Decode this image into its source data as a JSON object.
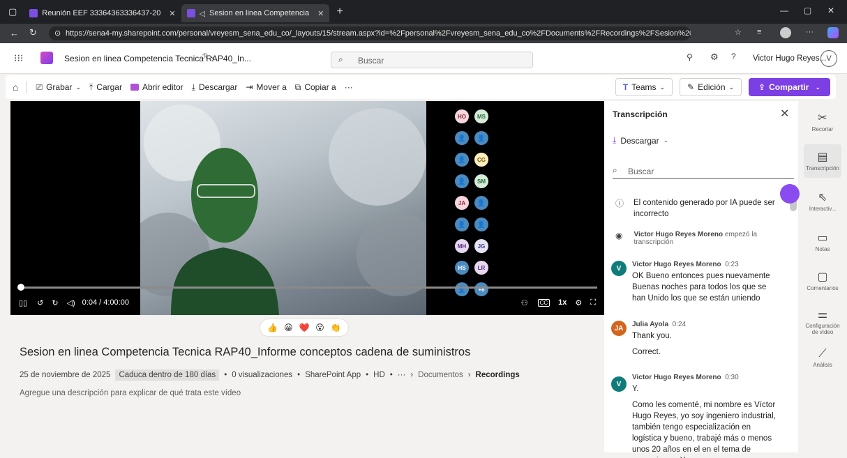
{
  "browser": {
    "tabs": [
      {
        "label": "Reunión EEF 33364363336437-20"
      },
      {
        "label": "Sesion en linea Competencia"
      }
    ],
    "url": "https://sena4-my.sharepoint.com/personal/vreyesm_sena_edu_co/_layouts/15/stream.aspx?id=%2Fpersonal%2Fvreyesm_sena_edu_co%2FDocuments%2FRecordings%2FSesion%20en%20..."
  },
  "app": {
    "file_title": "Sesion en linea Competencia Tecnica RAP40_In...",
    "search_placeholder": "Buscar",
    "user_name": "Victor Hugo Reyes...",
    "user_initial": "V"
  },
  "commands": {
    "record": "Grabar",
    "upload": "Cargar",
    "open_editor": "Abrir editor",
    "download": "Descargar",
    "move": "Mover a",
    "copy": "Copiar a",
    "more": "···",
    "teams": "Teams",
    "edit": "Edición",
    "share": "Compartir"
  },
  "player": {
    "time": "0:04 / 4:00:00",
    "speed": "1x",
    "cc": "CC",
    "progress_fraction": 0.0003,
    "participants": [
      {
        "initials": "HO",
        "bg": "#f6d6dc",
        "fg": "#8a2b3d"
      },
      {
        "initials": "MS",
        "bg": "#d5ecd9",
        "fg": "#2c6b3a"
      },
      {
        "initials": "",
        "bg": "#4b8bbf",
        "fg": "#ffffff"
      },
      {
        "initials": "",
        "bg": "#4b8bbf",
        "fg": "#ffffff"
      },
      {
        "initials": "",
        "bg": "#4b8bbf",
        "fg": "#ffffff"
      },
      {
        "initials": "CG",
        "bg": "#fbeec1",
        "fg": "#7a5a00"
      },
      {
        "initials": "",
        "bg": "#4b8bbf",
        "fg": "#ffffff"
      },
      {
        "initials": "SM",
        "bg": "#d5ecd9",
        "fg": "#2c6b3a"
      },
      {
        "initials": "JA",
        "bg": "#f6d6dc",
        "fg": "#8a2b3d"
      },
      {
        "initials": "",
        "bg": "#4b8bbf",
        "fg": "#ffffff"
      },
      {
        "initials": "",
        "bg": "#4b8bbf",
        "fg": "#ffffff"
      },
      {
        "initials": "",
        "bg": "#4b8bbf",
        "fg": "#ffffff"
      },
      {
        "initials": "MH",
        "bg": "#e6d7f0",
        "fg": "#5b2d7a"
      },
      {
        "initials": "JG",
        "bg": "#e3e3f3",
        "fg": "#3d3d8a"
      },
      {
        "initials": "HS",
        "bg": "#4b8bbf",
        "fg": "#ffffff"
      },
      {
        "initials": "LR",
        "bg": "#e6d7f0",
        "fg": "#5b2d7a"
      },
      {
        "initials": "",
        "bg": "#4b8bbf",
        "fg": "#ffffff"
      },
      {
        "initials": "+8",
        "bg": "#4b8bbf",
        "fg": "#ffffff"
      }
    ]
  },
  "reactions": [
    "👍",
    "😀",
    "❤️",
    "😮",
    "👏"
  ],
  "video_info": {
    "title": "Sesion en linea Competencia Tecnica RAP40_Informe conceptos cadena de suministros",
    "date": "25 de noviembre de 2025",
    "expiry": "Caduca dentro de 180 días",
    "views": "0 visualizaciones",
    "app": "SharePoint App",
    "quality": "HD",
    "more": "···",
    "crumb_docs": "Documentos",
    "crumb_recordings": "Recordings",
    "description_placeholder": "Agregue una descripción para explicar de qué trata este vídeo"
  },
  "transcript": {
    "title": "Transcripción",
    "download": "Descargar",
    "search_placeholder": "Buscar",
    "ai_notice": "El contenido generado por IA puede ser incorrecto",
    "started_name": "Victor Hugo Reyes Moreno",
    "started_text": "empezó la transcripción",
    "entries": [
      {
        "name": "Victor Hugo Reyes Moreno",
        "time": "0:23",
        "initial": "V",
        "color": "#0f7c7a",
        "text": "OK Bueno entonces pues nuevamente Buenas noches para todos los que se han Unido los que se están uniendo"
      },
      {
        "name": "Julia Ayola",
        "time": "0:24",
        "initial": "JA",
        "color": "#d2651e",
        "text": "Thank you.",
        "text2": "Correct."
      },
      {
        "name": "Victor Hugo Reyes Moreno",
        "time": "0:30",
        "initial": "V",
        "color": "#0f7c7a",
        "text": "Y.",
        "text2": "Como les comenté, mi nombre es Víctor Hugo Reyes, yo soy ingeniero industrial, también tengo especialización en logística y bueno, trabajé más o menos unos 20 años en el en el tema de operaciones. Ya"
      }
    ]
  },
  "rail": {
    "trim": "Recortar",
    "transcript": "Transcripción",
    "interactive": "Interactiv...",
    "notes": "Notas",
    "comments": "Comentarios",
    "video_settings": "Configuración de vídeo",
    "analytics": "Análisis"
  },
  "colors": {
    "accent": "#7b3fe4",
    "accent_light": "#8a4cf0"
  }
}
